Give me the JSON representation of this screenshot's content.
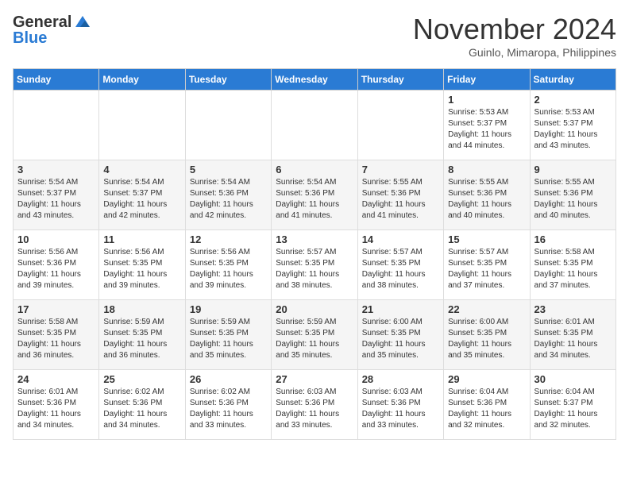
{
  "logo": {
    "line1": "General",
    "line2": "Blue"
  },
  "header": {
    "month": "November 2024",
    "location": "Guinlo, Mimaropa, Philippines"
  },
  "weekdays": [
    "Sunday",
    "Monday",
    "Tuesday",
    "Wednesday",
    "Thursday",
    "Friday",
    "Saturday"
  ],
  "weeks": [
    [
      {
        "day": "",
        "info": ""
      },
      {
        "day": "",
        "info": ""
      },
      {
        "day": "",
        "info": ""
      },
      {
        "day": "",
        "info": ""
      },
      {
        "day": "",
        "info": ""
      },
      {
        "day": "1",
        "info": "Sunrise: 5:53 AM\nSunset: 5:37 PM\nDaylight: 11 hours\nand 44 minutes."
      },
      {
        "day": "2",
        "info": "Sunrise: 5:53 AM\nSunset: 5:37 PM\nDaylight: 11 hours\nand 43 minutes."
      }
    ],
    [
      {
        "day": "3",
        "info": "Sunrise: 5:54 AM\nSunset: 5:37 PM\nDaylight: 11 hours\nand 43 minutes."
      },
      {
        "day": "4",
        "info": "Sunrise: 5:54 AM\nSunset: 5:37 PM\nDaylight: 11 hours\nand 42 minutes."
      },
      {
        "day": "5",
        "info": "Sunrise: 5:54 AM\nSunset: 5:36 PM\nDaylight: 11 hours\nand 42 minutes."
      },
      {
        "day": "6",
        "info": "Sunrise: 5:54 AM\nSunset: 5:36 PM\nDaylight: 11 hours\nand 41 minutes."
      },
      {
        "day": "7",
        "info": "Sunrise: 5:55 AM\nSunset: 5:36 PM\nDaylight: 11 hours\nand 41 minutes."
      },
      {
        "day": "8",
        "info": "Sunrise: 5:55 AM\nSunset: 5:36 PM\nDaylight: 11 hours\nand 40 minutes."
      },
      {
        "day": "9",
        "info": "Sunrise: 5:55 AM\nSunset: 5:36 PM\nDaylight: 11 hours\nand 40 minutes."
      }
    ],
    [
      {
        "day": "10",
        "info": "Sunrise: 5:56 AM\nSunset: 5:36 PM\nDaylight: 11 hours\nand 39 minutes."
      },
      {
        "day": "11",
        "info": "Sunrise: 5:56 AM\nSunset: 5:35 PM\nDaylight: 11 hours\nand 39 minutes."
      },
      {
        "day": "12",
        "info": "Sunrise: 5:56 AM\nSunset: 5:35 PM\nDaylight: 11 hours\nand 39 minutes."
      },
      {
        "day": "13",
        "info": "Sunrise: 5:57 AM\nSunset: 5:35 PM\nDaylight: 11 hours\nand 38 minutes."
      },
      {
        "day": "14",
        "info": "Sunrise: 5:57 AM\nSunset: 5:35 PM\nDaylight: 11 hours\nand 38 minutes."
      },
      {
        "day": "15",
        "info": "Sunrise: 5:57 AM\nSunset: 5:35 PM\nDaylight: 11 hours\nand 37 minutes."
      },
      {
        "day": "16",
        "info": "Sunrise: 5:58 AM\nSunset: 5:35 PM\nDaylight: 11 hours\nand 37 minutes."
      }
    ],
    [
      {
        "day": "17",
        "info": "Sunrise: 5:58 AM\nSunset: 5:35 PM\nDaylight: 11 hours\nand 36 minutes."
      },
      {
        "day": "18",
        "info": "Sunrise: 5:59 AM\nSunset: 5:35 PM\nDaylight: 11 hours\nand 36 minutes."
      },
      {
        "day": "19",
        "info": "Sunrise: 5:59 AM\nSunset: 5:35 PM\nDaylight: 11 hours\nand 35 minutes."
      },
      {
        "day": "20",
        "info": "Sunrise: 5:59 AM\nSunset: 5:35 PM\nDaylight: 11 hours\nand 35 minutes."
      },
      {
        "day": "21",
        "info": "Sunrise: 6:00 AM\nSunset: 5:35 PM\nDaylight: 11 hours\nand 35 minutes."
      },
      {
        "day": "22",
        "info": "Sunrise: 6:00 AM\nSunset: 5:35 PM\nDaylight: 11 hours\nand 35 minutes."
      },
      {
        "day": "23",
        "info": "Sunrise: 6:01 AM\nSunset: 5:35 PM\nDaylight: 11 hours\nand 34 minutes."
      }
    ],
    [
      {
        "day": "24",
        "info": "Sunrise: 6:01 AM\nSunset: 5:36 PM\nDaylight: 11 hours\nand 34 minutes."
      },
      {
        "day": "25",
        "info": "Sunrise: 6:02 AM\nSunset: 5:36 PM\nDaylight: 11 hours\nand 34 minutes."
      },
      {
        "day": "26",
        "info": "Sunrise: 6:02 AM\nSunset: 5:36 PM\nDaylight: 11 hours\nand 33 minutes."
      },
      {
        "day": "27",
        "info": "Sunrise: 6:03 AM\nSunset: 5:36 PM\nDaylight: 11 hours\nand 33 minutes."
      },
      {
        "day": "28",
        "info": "Sunrise: 6:03 AM\nSunset: 5:36 PM\nDaylight: 11 hours\nand 33 minutes."
      },
      {
        "day": "29",
        "info": "Sunrise: 6:04 AM\nSunset: 5:36 PM\nDaylight: 11 hours\nand 32 minutes."
      },
      {
        "day": "30",
        "info": "Sunrise: 6:04 AM\nSunset: 5:37 PM\nDaylight: 11 hours\nand 32 minutes."
      }
    ]
  ]
}
